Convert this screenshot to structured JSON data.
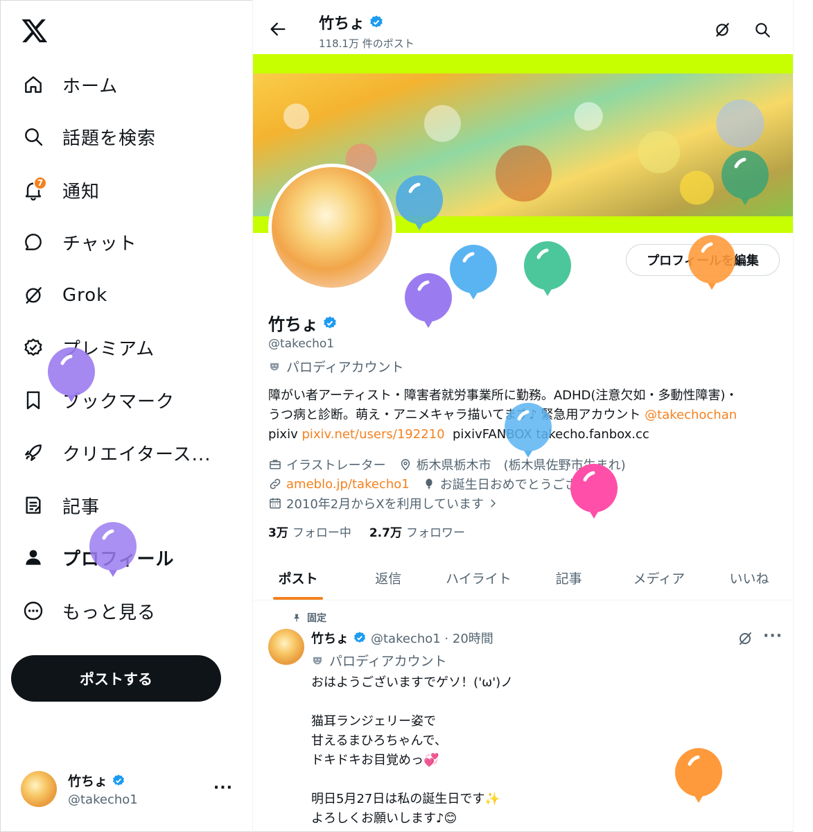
{
  "sidebar": {
    "items": [
      {
        "label": "ホーム",
        "icon": "home-icon"
      },
      {
        "label": "話題を検索",
        "icon": "search-icon"
      },
      {
        "label": "通知",
        "icon": "bell-icon",
        "badge": "7"
      },
      {
        "label": "チャット",
        "icon": "chat-icon"
      },
      {
        "label": "Grok",
        "icon": "grok-icon"
      },
      {
        "label": "プレミアム",
        "icon": "premium-icon"
      },
      {
        "label": "ブックマーク",
        "icon": "bookmark-icon"
      },
      {
        "label": "クリエイタース...",
        "icon": "rocket-icon"
      },
      {
        "label": "記事",
        "icon": "article-icon"
      },
      {
        "label": "プロフィール",
        "icon": "person-icon"
      },
      {
        "label": "もっと見る",
        "icon": "more-circle-icon"
      }
    ],
    "post_button": "ポストする",
    "account": {
      "name": "竹ちょ",
      "handle": "@takecho1",
      "more": "···"
    }
  },
  "header": {
    "name": "竹ちょ",
    "post_count": "118.1万 件のポスト"
  },
  "profile": {
    "edit_button": "プロフィールを編集",
    "name": "竹ちょ",
    "handle": "@takecho1",
    "parody": "パロディアカウント",
    "bio_line1": "障がい者アーティスト・障害者就労事業所に勤務。ADHD(注意欠如・多動性障害)・",
    "bio_line2_text": "うつ病と診断。萌え・アニメキャラ描いてます♪ 緊急用アカウント ",
    "bio_line2_link": "@takechochan",
    "bio_line3_a": "pixiv ",
    "bio_line3_link1": "pixiv.net/users/192210",
    "bio_line3_b": "  pixivFANBOX ",
    "bio_line3_link2": "takecho.fanbox.cc",
    "job": "イラストレーター",
    "location": "栃木県栃木市　(栃木県佐野市生まれ)",
    "website": "ameblo.jp/takecho1",
    "birthday": "お誕生日おめでとうございます。",
    "joined": "2010年2月からXを利用しています",
    "following_count": "3万",
    "following_label": "フォロー中",
    "followers_count": "2.7万",
    "followers_label": "フォロワー"
  },
  "tabs": [
    "ポスト",
    "返信",
    "ハイライト",
    "記事",
    "メディア",
    "いいね"
  ],
  "post": {
    "pinned": "固定",
    "name": "竹ちょ",
    "meta": "@takecho1 · 20時間",
    "parody": "パロディアカウント",
    "lines": [
      "おはようございますでゲソ！('ω')ノ",
      "",
      "猫耳ランジェリー姿で",
      "甘えるまひろちゃんで、",
      "ドキドキお目覚めっ💞",
      "",
      "明日5月27日は私の誕生日です✨",
      "よろしくお願いします♪😊"
    ],
    "more": "···"
  },
  "colors": {
    "accent": "#f4811f",
    "verified": "#1d9bf0",
    "banner_bg": "#c8ff00",
    "text": "#0f1419",
    "muted": "#536471"
  }
}
